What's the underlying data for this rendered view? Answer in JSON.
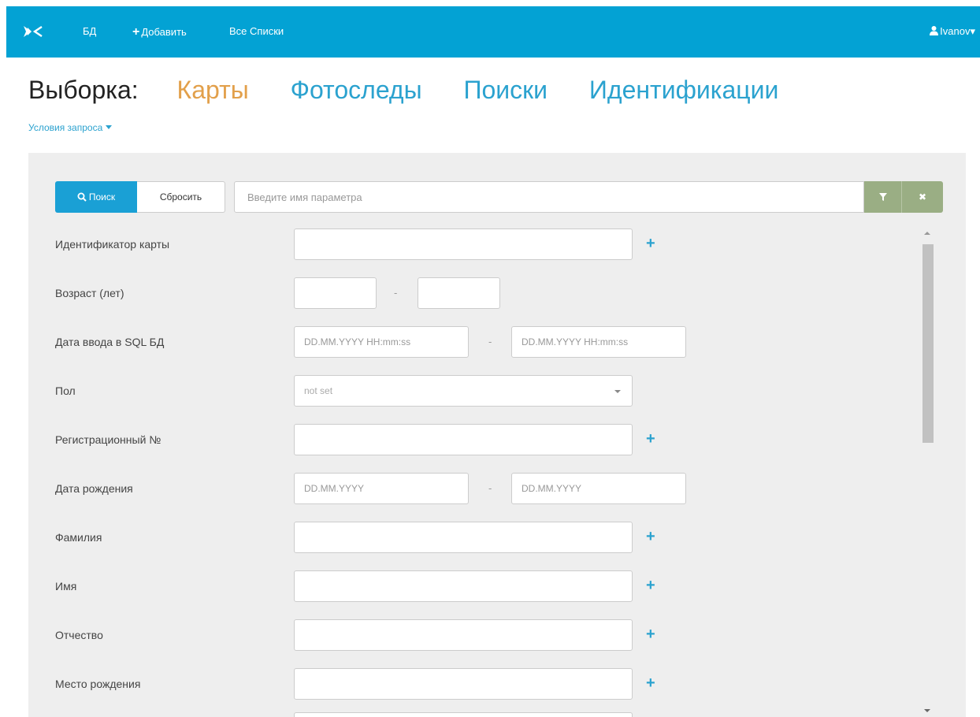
{
  "navbar": {
    "logo_icon": "butterfly-logo-icon",
    "db_label": "БД",
    "add_label": "Добавить",
    "add_plus": "+",
    "lists_label": "Все Списки",
    "user_label": "Ivanov",
    "user_caret": "▾",
    "bg_color": "#03a2d4"
  },
  "heading": {
    "label": "Выборка:",
    "tabs": [
      {
        "label": "Карты",
        "active": true
      },
      {
        "label": "Фотоследы",
        "active": false
      },
      {
        "label": "Поиски",
        "active": false
      },
      {
        "label": "Идентификации",
        "active": false
      }
    ],
    "active_color": "#e2a04b",
    "link_color": "#2ba2cf"
  },
  "conditions_label": "Условия запроса",
  "toolbar": {
    "search_label": "Поиск",
    "reset_label": "Сбросить",
    "param_placeholder": "Введите имя параметра",
    "clear_glyph": "✖",
    "accent": "#9aae84"
  },
  "form": {
    "card_id": {
      "label": "Идентификатор карты",
      "plus": "+"
    },
    "age": {
      "label": "Возраст (лет)",
      "dash": "-"
    },
    "sql_date": {
      "label": "Дата ввода в SQL БД",
      "from_placeholder": "DD.MM.YYYY HH:mm:ss",
      "to_placeholder": "DD.MM.YYYY HH:mm:ss",
      "dash": "-"
    },
    "sex": {
      "label": "Пол",
      "value": "not set"
    },
    "reg_no": {
      "label": "Регистрационный №",
      "plus": "+"
    },
    "birth_date": {
      "label": "Дата рождения",
      "from_placeholder": "DD.MM.YYYY",
      "to_placeholder": "DD.MM.YYYY",
      "dash": "-"
    },
    "surname": {
      "label": "Фамилия",
      "plus": "+"
    },
    "name": {
      "label": "Имя",
      "plus": "+"
    },
    "patronymic": {
      "label": "Отчество",
      "plus": "+"
    },
    "birth_place": {
      "label": "Место рождения",
      "plus": "+"
    }
  }
}
